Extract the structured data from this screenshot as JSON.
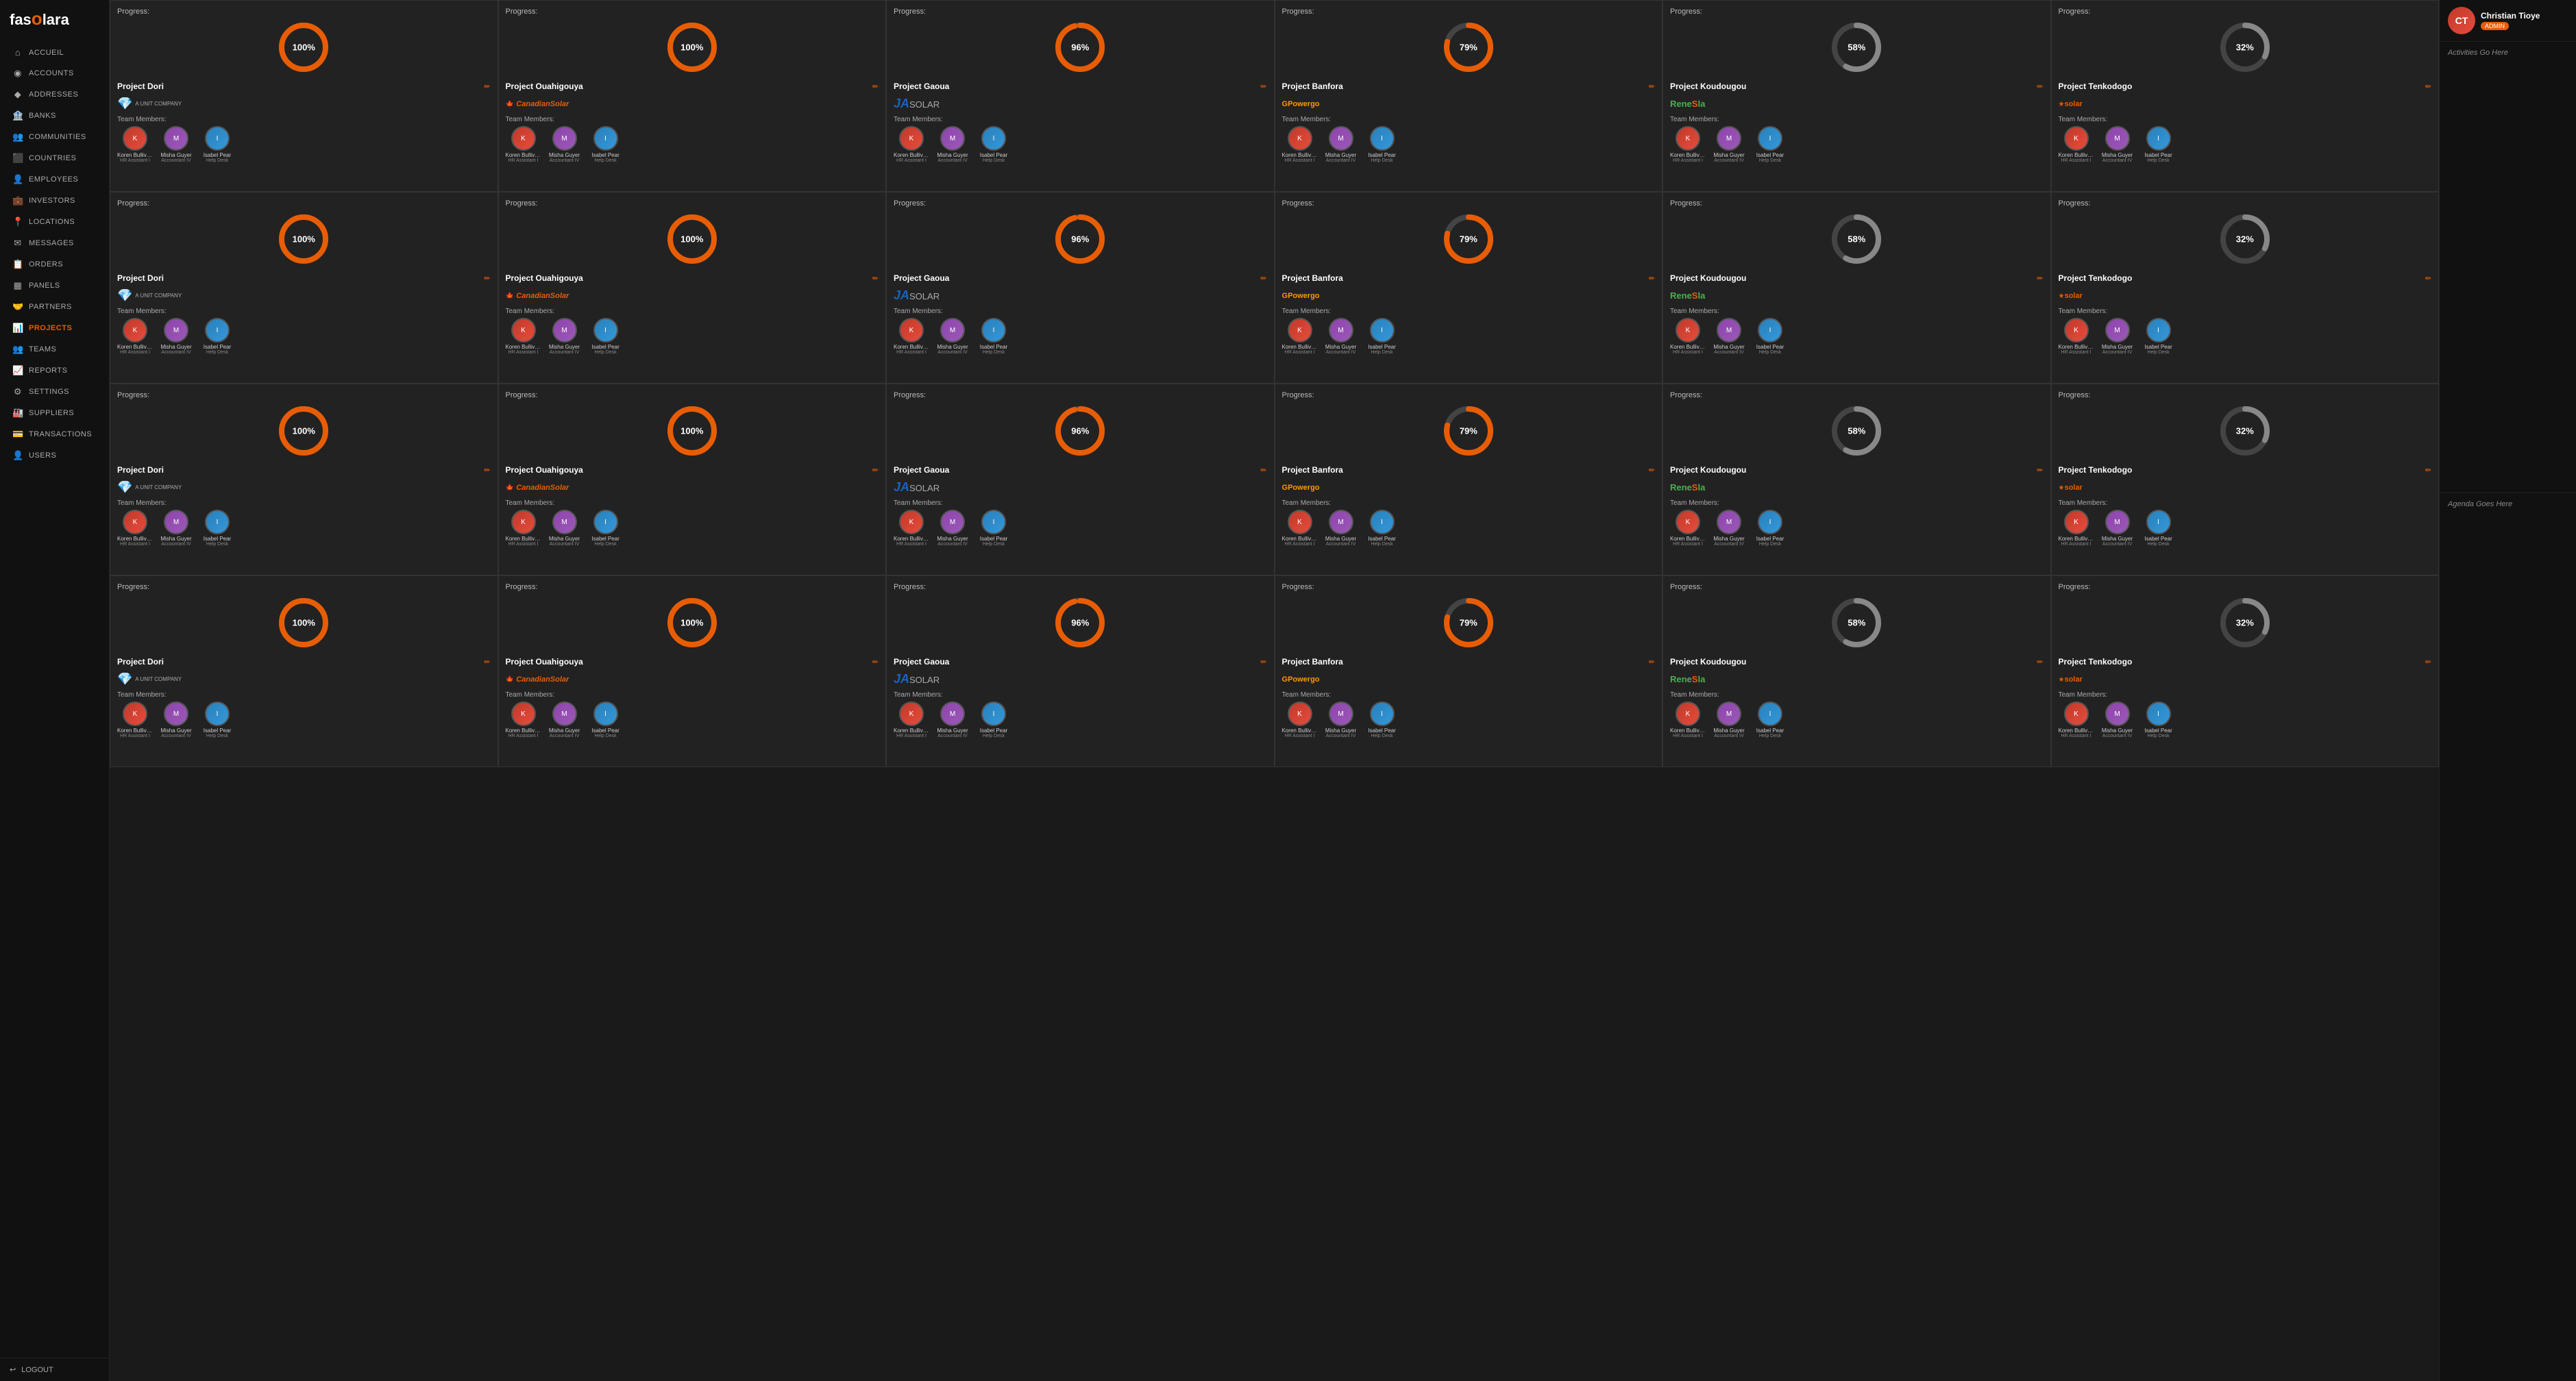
{
  "sidebar": {
    "logo": "fasolara",
    "items": [
      {
        "label": "ACCUEIL",
        "icon": "⌂",
        "active": false
      },
      {
        "label": "ACCOUNTS",
        "icon": "◉",
        "active": false
      },
      {
        "label": "ADDRESSES",
        "icon": "◆",
        "active": false
      },
      {
        "label": "BANKS",
        "icon": "🏦",
        "active": false
      },
      {
        "label": "COMMUNITIES",
        "icon": "👥",
        "active": false
      },
      {
        "label": "COUNTRIES",
        "icon": "⬛",
        "active": false
      },
      {
        "label": "EMPLOYEES",
        "icon": "👤",
        "active": false
      },
      {
        "label": "INVESTORS",
        "icon": "💼",
        "active": false
      },
      {
        "label": "LOCATIONS",
        "icon": "📍",
        "active": false
      },
      {
        "label": "MESSAGES",
        "icon": "✉",
        "active": false
      },
      {
        "label": "ORDERS",
        "icon": "📋",
        "active": false
      },
      {
        "label": "PANELS",
        "icon": "▦",
        "active": false
      },
      {
        "label": "PARTNERS",
        "icon": "🤝",
        "active": false
      },
      {
        "label": "PROJECTS",
        "icon": "📊",
        "active": true
      },
      {
        "label": "TEAMS",
        "icon": "👥",
        "active": false
      },
      {
        "label": "REPORTS",
        "icon": "📈",
        "active": false
      },
      {
        "label": "SETTINGS",
        "icon": "⚙",
        "active": false
      },
      {
        "label": "SUPPLIERS",
        "icon": "🏭",
        "active": false
      },
      {
        "label": "TRANSACTIONS",
        "icon": "💳",
        "active": false
      },
      {
        "label": "USERS",
        "icon": "👤",
        "active": false
      }
    ],
    "logout": "LOGOUT"
  },
  "header": {
    "user_name": "Christian Tioye",
    "user_badge": "ADMIN",
    "activities_label": "Activities Go Here",
    "agenda_label": "Agenda Goes Here"
  },
  "projects": [
    {
      "progress": 100,
      "title": "Project Dori",
      "logo_type": "dori",
      "color": "#e85d04",
      "members": [
        {
          "name": "Koren Bullivent",
          "role": "HR Assistant I",
          "type": "koren"
        },
        {
          "name": "Misha Guyer",
          "role": "Accountant IV",
          "type": "misha"
        },
        {
          "name": "Isabel Pear",
          "role": "Help Desk",
          "type": "isabel"
        }
      ]
    },
    {
      "progress": 100,
      "title": "Project Ouahigouya",
      "logo_type": "canadian",
      "color": "#e85d04",
      "members": [
        {
          "name": "Koren Bullivent",
          "role": "HR Assistant I",
          "type": "koren"
        },
        {
          "name": "Misha Guyer",
          "role": "Accountant IV",
          "type": "misha"
        },
        {
          "name": "Isabel Pear",
          "role": "Help Desk",
          "type": "isabel"
        }
      ]
    },
    {
      "progress": 96,
      "title": "Project Gaoua",
      "logo_type": "ja",
      "color": "#e85d04",
      "members": [
        {
          "name": "Koren Bullivent",
          "role": "HR Assistant I",
          "type": "koren"
        },
        {
          "name": "Misha Guyer",
          "role": "Accountant IV",
          "type": "misha"
        },
        {
          "name": "Isabel Pear",
          "role": "Help Desk",
          "type": "isabel"
        }
      ]
    },
    {
      "progress": 79,
      "title": "Project Banfora",
      "logo_type": "powergo",
      "color": "#e85d04",
      "members": [
        {
          "name": "Koren Bullivent",
          "role": "HR Assistant I",
          "type": "koren"
        },
        {
          "name": "Misha Guyer",
          "role": "Accountant IV",
          "type": "misha"
        },
        {
          "name": "Isabel Pear",
          "role": "Help Desk",
          "type": "isabel"
        }
      ]
    },
    {
      "progress": 58,
      "title": "Project Koudougou",
      "logo_type": "renesola",
      "color": "#888",
      "members": [
        {
          "name": "Koren Bullivent",
          "role": "HR Assistant I",
          "type": "koren"
        },
        {
          "name": "Misha Guyer",
          "role": "Accountant IV",
          "type": "misha"
        },
        {
          "name": "Isabel Pear",
          "role": "Help Desk",
          "type": "isabel"
        }
      ]
    },
    {
      "progress": 32,
      "title": "Project Tenkodogo",
      "logo_type": "solar",
      "color": "#888",
      "members": [
        {
          "name": "Koren Bullivent",
          "role": "HR Assistant I",
          "type": "koren"
        },
        {
          "name": "Misha Guyer",
          "role": "Accountant IV",
          "type": "misha"
        },
        {
          "name": "Isabel Pear",
          "role": "Help Desk",
          "type": "isabel"
        }
      ]
    }
  ],
  "labels": {
    "progress": "Progress:",
    "team_members": "Team Members:",
    "edit_icon": "✏",
    "logout": "LOGOUT"
  }
}
